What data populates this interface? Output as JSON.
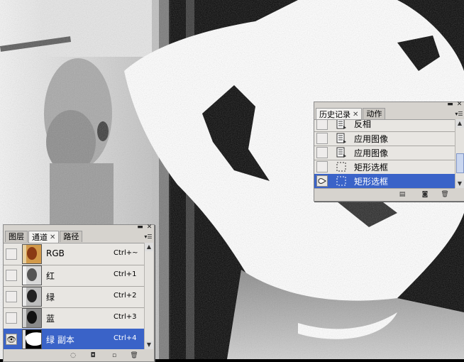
{
  "history_panel": {
    "tabs": [
      {
        "label": "历史记录",
        "closable": true,
        "active": true
      },
      {
        "label": "动作",
        "closable": false,
        "active": false
      }
    ],
    "items": [
      {
        "label": "反相",
        "icon": "history-state-icon",
        "selected": false
      },
      {
        "label": "应用图像",
        "icon": "history-state-icon",
        "selected": false
      },
      {
        "label": "应用图像",
        "icon": "history-state-icon",
        "selected": false
      },
      {
        "label": "矩形选框",
        "icon": "marquee-icon",
        "selected": false
      },
      {
        "label": "矩形选框",
        "icon": "marquee-icon",
        "selected": true
      }
    ],
    "scroll_position": 0.75
  },
  "channels_panel": {
    "tabs": [
      {
        "label": "图层",
        "closable": false,
        "active": false
      },
      {
        "label": "通道",
        "closable": true,
        "active": true
      },
      {
        "label": "路径",
        "closable": false,
        "active": false
      }
    ],
    "channels": [
      {
        "name": "RGB",
        "shortcut": "Ctrl+~",
        "visible": false,
        "selected": false,
        "thumb": "color"
      },
      {
        "name": "红",
        "shortcut": "Ctrl+1",
        "visible": false,
        "selected": false,
        "thumb": "gray"
      },
      {
        "name": "绿",
        "shortcut": "Ctrl+2",
        "visible": false,
        "selected": false,
        "thumb": "gray"
      },
      {
        "name": "蓝",
        "shortcut": "Ctrl+3",
        "visible": false,
        "selected": false,
        "thumb": "dark"
      },
      {
        "name": "绿 副本",
        "shortcut": "Ctrl+4",
        "visible": true,
        "selected": true,
        "thumb": "mask"
      }
    ]
  },
  "colors": {
    "selection": "#3a63c8",
    "panel_bg": "#d6d3ce"
  }
}
